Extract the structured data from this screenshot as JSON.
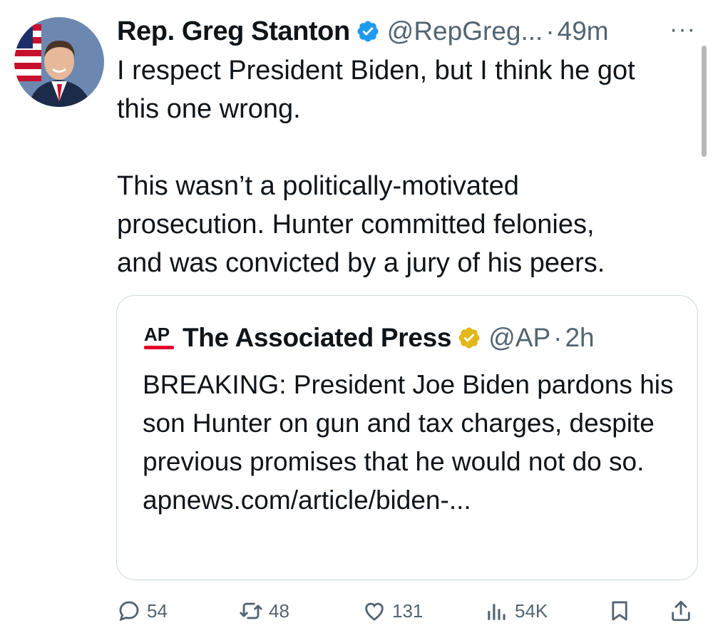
{
  "tweet": {
    "author_name": "Rep. Greg Stanton",
    "handle": "@RepGreg...",
    "separator": "·",
    "time": "49m",
    "more_label": "···",
    "text": "I respect President Biden, but I think he got\nthis one wrong.\n\nThis wasn’t a politically-motivated\nprosecution. Hunter committed felonies,\nand was convicted by a jury of his peers."
  },
  "quote": {
    "logo_text": "AP",
    "author_name": "The Associated Press",
    "handle": "@AP",
    "separator": "·",
    "time": "2h",
    "text": "BREAKING: President Joe Biden pardons his son Hunter on gun and tax charges, despite previous promises that he would not do so. apnews.com/article/biden-..."
  },
  "actions": {
    "replies": "54",
    "reposts": "48",
    "likes": "131",
    "views": "54K"
  },
  "colors": {
    "text": "#0f1419",
    "secondary": "#536471",
    "verified_blue": "#1d9bf0",
    "verified_gold": "#e2b719",
    "border": "#cfd9de",
    "ap_red": "#e4002b"
  },
  "icons": [
    "reply-icon",
    "repost-icon",
    "like-icon",
    "views-icon",
    "bookmark-icon",
    "share-icon",
    "verified-badge-icon"
  ]
}
